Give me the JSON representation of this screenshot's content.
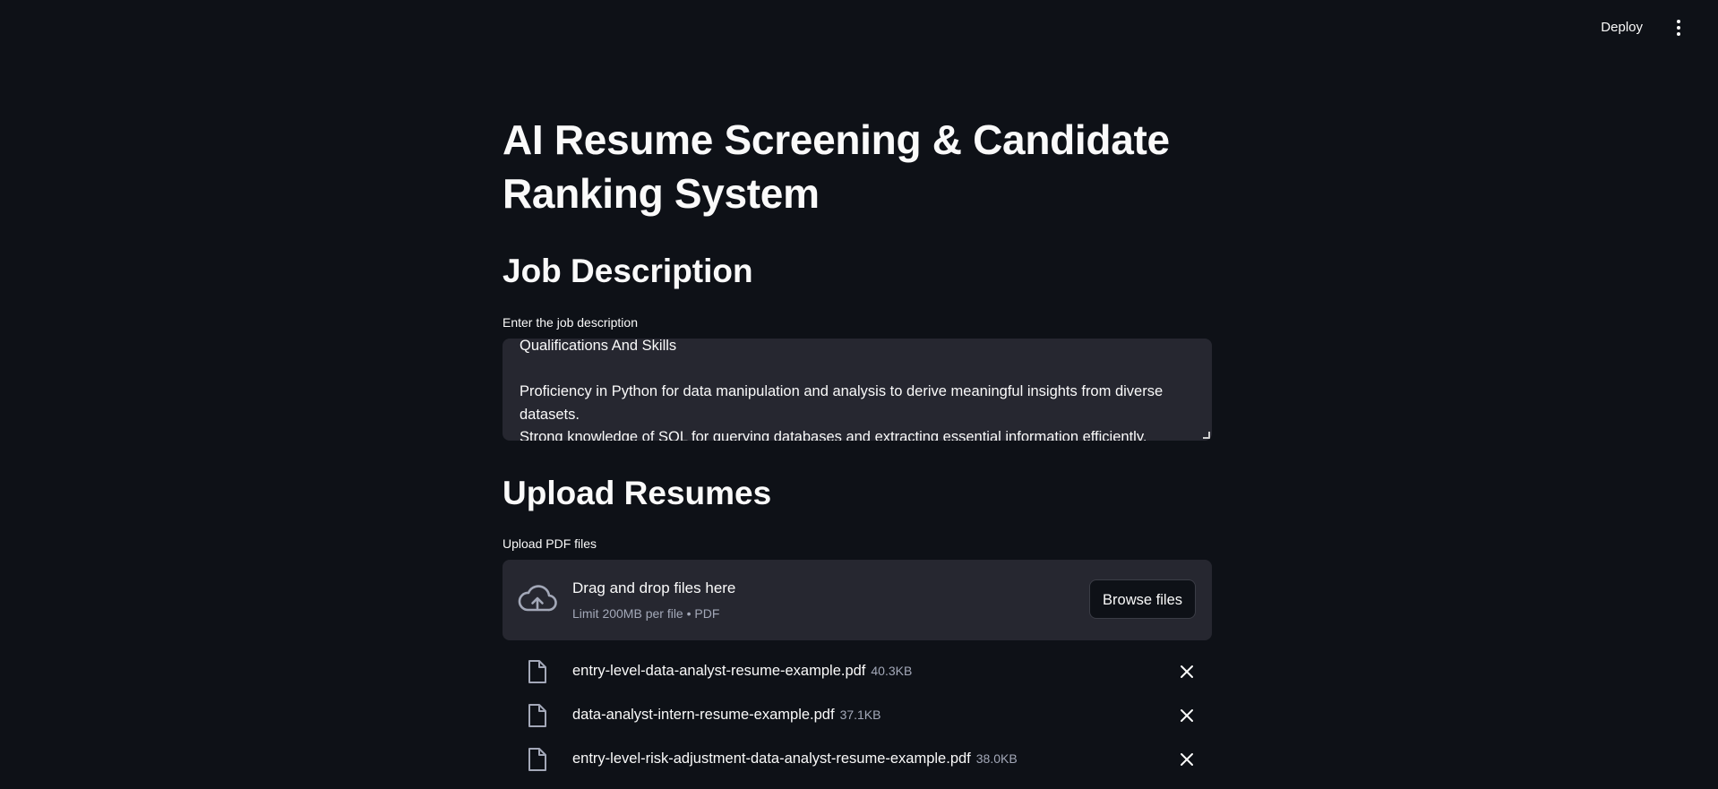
{
  "header": {
    "deploy_label": "Deploy",
    "menu_icon": "vertical-ellipsis-icon"
  },
  "page": {
    "title": "AI Resume Screening & Candidate Ranking System"
  },
  "job_description": {
    "heading": "Job Description",
    "label": "Enter the job description",
    "value": "Qualifications And Skills\n\nProficiency in Python for data manipulation and analysis to derive meaningful insights from diverse datasets.\nStrong knowledge of SQL for querying databases and extracting essential information efficiently."
  },
  "upload": {
    "heading": "Upload Resumes",
    "label": "Upload PDF files",
    "dropzone_title": "Drag and drop files here",
    "dropzone_subtitle": "Limit 200MB per file • PDF",
    "browse_label": "Browse files",
    "upload_icon": "cloud-upload-icon",
    "files": [
      {
        "name": "entry-level-data-analyst-resume-example.pdf",
        "size": "40.3KB"
      },
      {
        "name": "data-analyst-intern-resume-example.pdf",
        "size": "37.1KB"
      },
      {
        "name": "entry-level-risk-adjustment-data-analyst-resume-example.pdf",
        "size": "38.0KB"
      }
    ]
  },
  "colors": {
    "background": "#0e1117",
    "surface": "#262730",
    "text": "#fafafa",
    "muted_text": "#a3a8b8"
  }
}
